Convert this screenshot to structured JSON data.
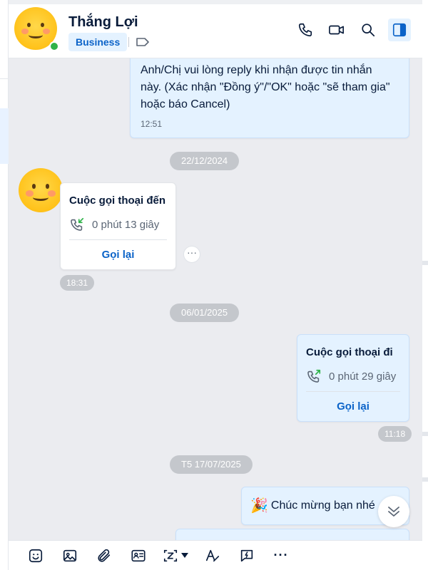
{
  "header": {
    "contact_name": "Thắng Lợi",
    "tag": "Business",
    "online": true,
    "actions": [
      "phone-icon",
      "video-call-icon",
      "search-icon",
      "sidebar-toggle-icon"
    ]
  },
  "messages": {
    "top_outgoing": {
      "text": "Anh/Chị vui lòng reply khi nhận được tin nhắn này. (Xác nhận \"Đồng ý\"/\"OK\" hoặc \"sẽ tham gia\" hoặc báo Cancel)",
      "line1": "Anh/Chị vui lòng reply khi nhận được tin nhắn",
      "line2": "này. (Xác nhận \"Đồng ý\"/\"OK\" hoặc \"sẽ tham gia\"",
      "line3": "hoặc báo Cancel)",
      "time": "12:51"
    },
    "date1": "22/12/2024",
    "incoming_call": {
      "title": "Cuộc gọi thoại đến",
      "duration": "0 phút 13 giây",
      "action": "Gọi lại",
      "time": "18:31",
      "more": "···"
    },
    "date2": "06/01/2025",
    "outgoing_call": {
      "title": "Cuộc gọi thoại đi",
      "duration": "0 phút 29 giây",
      "action": "Gọi lại",
      "time": "11:18"
    },
    "date3": "T5 17/07/2025",
    "last_outgoing": {
      "emoji": "🎉",
      "text": "Chúc mừng bạn nhé"
    }
  },
  "toolbar": {
    "icons": [
      "sticker-icon",
      "image-icon",
      "attachment-icon",
      "contact-card-icon",
      "screenshot-icon",
      "text-format-icon",
      "quick-message-icon",
      "more-icon"
    ],
    "more_label": "···"
  },
  "colors": {
    "accent": "#0b63c8",
    "bubble_out": "#e4f2ff",
    "chat_bg": "#ebecf0",
    "online": "#2fb34a"
  }
}
